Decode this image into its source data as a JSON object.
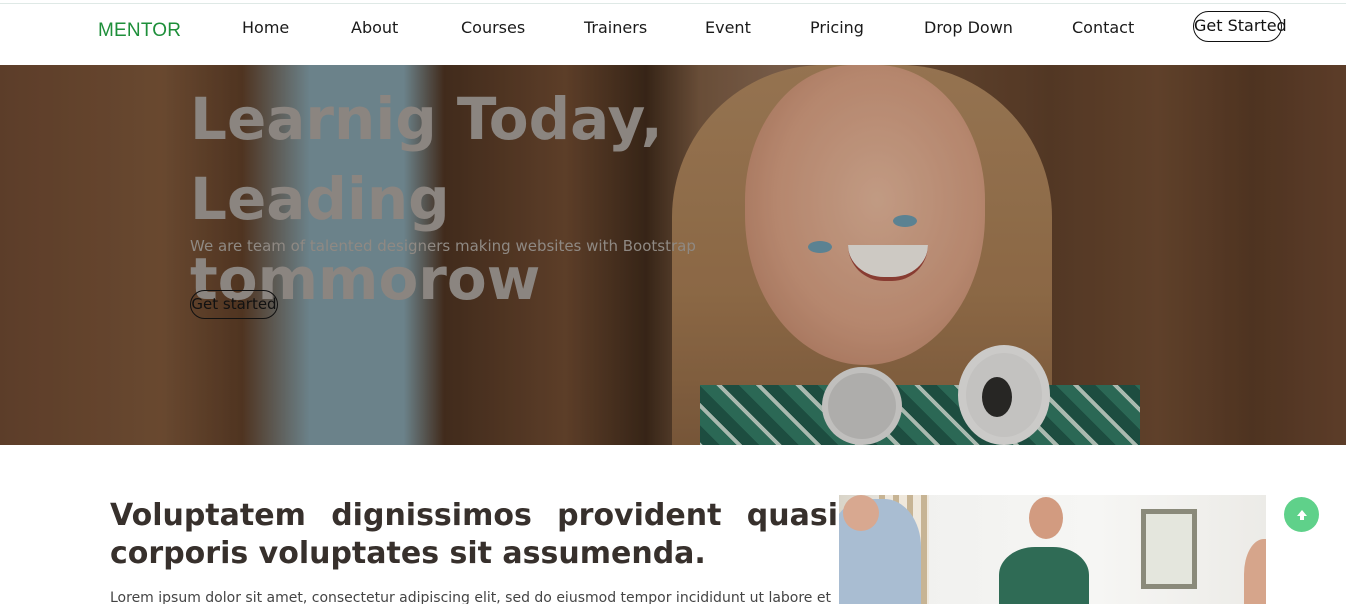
{
  "brand": {
    "name": "MENTOR",
    "color": "#1e8f3a"
  },
  "nav": {
    "items": [
      {
        "label": "Home"
      },
      {
        "label": "About"
      },
      {
        "label": "Courses"
      },
      {
        "label": "Trainers"
      },
      {
        "label": "Event"
      },
      {
        "label": "Pricing"
      },
      {
        "label": "Drop Down"
      },
      {
        "label": "Contact"
      }
    ],
    "cta": "Get Started"
  },
  "hero": {
    "title_line1": "Learnig Today,",
    "title_line2": "Leading tommorow",
    "tagline": "We are team of talented designers making websites with Bootstrap",
    "button": "Get started"
  },
  "about": {
    "title": "Voluptatem dignissimos provident quasi corporis voluptates sit assumenda.",
    "text": "Lorem ipsum dolor sit amet, consectetur adipiscing elit, sed do eiusmod tempor incididunt ut labore et"
  },
  "scroll_top": {
    "icon": "arrow-up-icon",
    "color": "#5fd18a"
  }
}
